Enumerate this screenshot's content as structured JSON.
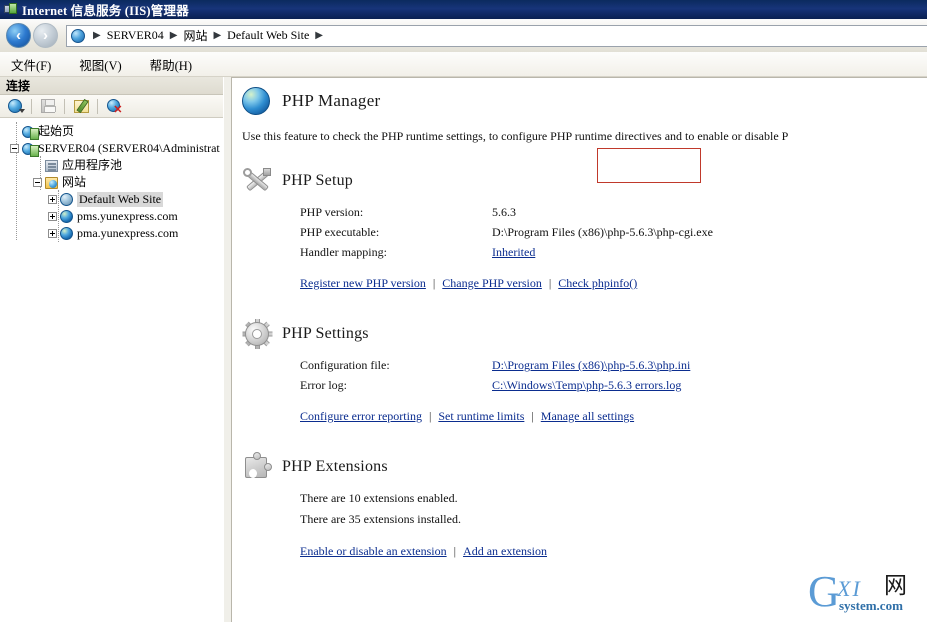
{
  "window": {
    "title": "Internet 信息服务 (IIS)管理器",
    "icon": "iis-icon"
  },
  "nav": {
    "back_icon": "back-arrow-icon",
    "forward_icon": "forward-arrow-icon",
    "breadcrumb_icon": "globe-icon",
    "breadcrumb": [
      "SERVER04",
      "网站",
      "Default Web Site"
    ],
    "separator": "▶"
  },
  "menu": {
    "items": [
      {
        "label": "文件(F)",
        "name": "menu-file"
      },
      {
        "label": "视图(V)",
        "name": "menu-view"
      },
      {
        "label": "帮助(H)",
        "name": "menu-help"
      }
    ]
  },
  "connections": {
    "header": "连接",
    "toolbar": [
      {
        "name": "connect-to-icon",
        "icon": "globe-dropdown-icon"
      },
      {
        "name": "save-connections-icon",
        "icon": "save-icon"
      },
      {
        "name": "edit-connection-icon",
        "icon": "edit-icon"
      },
      {
        "name": "disconnect-icon",
        "icon": "globe-disconnect-icon"
      }
    ],
    "tree": [
      {
        "label": "起始页",
        "icon": "start-page-icon",
        "depth": 0,
        "expander": "none",
        "selected": false
      },
      {
        "label": "SERVER04 (SERVER04\\Administrat",
        "icon": "server-icon",
        "depth": 0,
        "expander": "minus",
        "selected": false
      },
      {
        "label": "应用程序池",
        "icon": "app-pools-icon",
        "depth": 1,
        "expander": "none",
        "selected": false
      },
      {
        "label": "网站",
        "icon": "sites-folder-icon",
        "depth": 1,
        "expander": "minus",
        "selected": false
      },
      {
        "label": "Default Web Site",
        "icon": "web-site-icon",
        "depth": 2,
        "expander": "plus",
        "selected": true
      },
      {
        "label": "pms.yunexpress.com",
        "icon": "web-site-icon",
        "depth": 2,
        "expander": "plus",
        "selected": false
      },
      {
        "label": "pma.yunexpress.com",
        "icon": "web-site-icon",
        "depth": 2,
        "expander": "plus",
        "selected": false
      }
    ]
  },
  "feature": {
    "icon": "php-manager-globe-icon",
    "title": "PHP Manager",
    "description": "Use this feature to check the PHP runtime settings, to configure PHP runtime directives and to enable or disable P"
  },
  "php_setup": {
    "icon": "tools-icon",
    "title": "PHP Setup",
    "rows": [
      {
        "label": "PHP version:",
        "value": "5.6.3",
        "is_link": false
      },
      {
        "label": "PHP executable:",
        "value": "D:\\Program Files (x86)\\php-5.6.3\\php-cgi.exe",
        "is_link": false
      },
      {
        "label": "Handler mapping:",
        "value": "Inherited",
        "is_link": true
      }
    ],
    "links": [
      {
        "label": "Register new PHP version",
        "name": "register-new-php-version-link",
        "highlighted": false
      },
      {
        "label": "Change PHP version",
        "name": "change-php-version-link",
        "highlighted": false
      },
      {
        "label": "Check phpinfo()",
        "name": "check-phpinfo-link",
        "highlighted": true
      }
    ]
  },
  "php_settings": {
    "icon": "gear-icon",
    "title": "PHP Settings",
    "rows": [
      {
        "label": "Configuration file:",
        "value": "D:\\Program Files (x86)\\php-5.6.3\\php.ini",
        "is_link": true
      },
      {
        "label": "Error log:",
        "value": "C:\\Windows\\Temp\\php-5.6.3 errors.log",
        "is_link": true
      }
    ],
    "links": [
      {
        "label": "Configure error reporting",
        "name": "configure-error-reporting-link"
      },
      {
        "label": "Set runtime limits",
        "name": "set-runtime-limits-link"
      },
      {
        "label": "Manage all settings",
        "name": "manage-all-settings-link"
      }
    ]
  },
  "php_extensions": {
    "icon": "puzzle-icon",
    "title": "PHP Extensions",
    "lines": [
      "There are 10 extensions enabled.",
      "There are 35 extensions installed."
    ],
    "links": [
      {
        "label": "Enable or disable an extension",
        "name": "enable-disable-extension-link"
      },
      {
        "label": "Add an extension",
        "name": "add-an-extension-link"
      }
    ]
  },
  "watermark": {
    "g": "G",
    "xi": "XI",
    "cn": "网",
    "domain": "system.com"
  },
  "colors": {
    "titlebar": "#0b2a5e",
    "link": "#0b2d8f",
    "highlight_border": "#c0392b",
    "selection": "#d8d8d8",
    "watermark": "#5b9bd5"
  }
}
